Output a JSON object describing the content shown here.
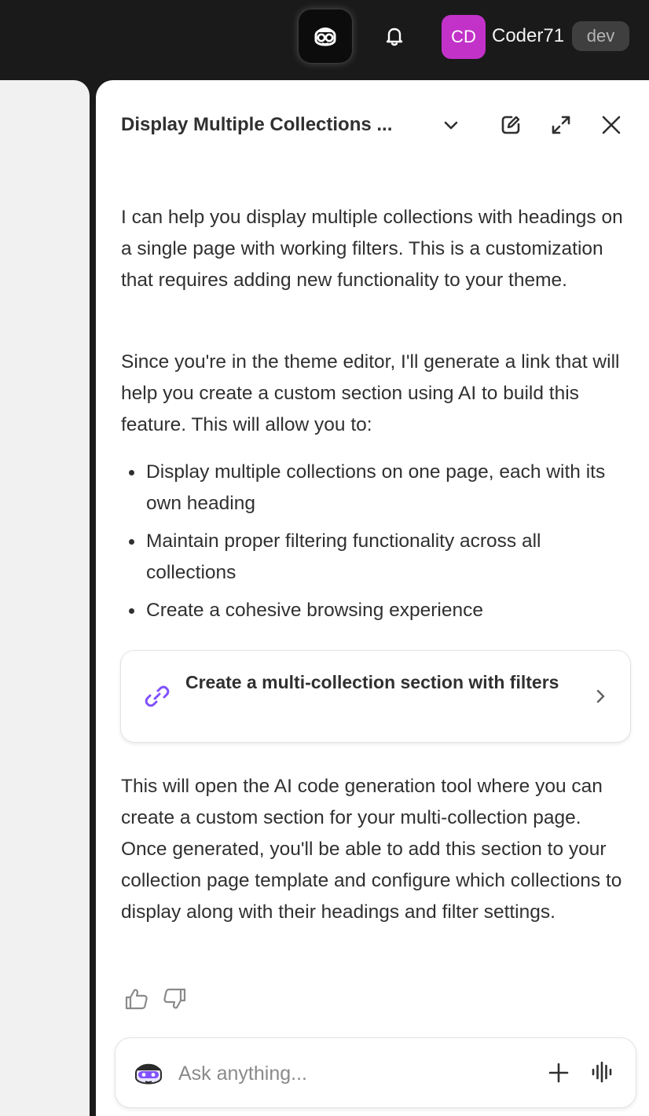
{
  "topbar": {
    "sidekick_icon": "sidekick-face-icon",
    "bell_icon": "bell-icon",
    "avatar_initials": "CD",
    "avatar_color": "#c232c9",
    "username": "Coder71",
    "badge": "dev"
  },
  "chat": {
    "title": "Display Multiple Collections ...",
    "header_icons": [
      "chevron-down-icon",
      "compose-icon",
      "expand-icon",
      "close-icon"
    ],
    "paragraph1": "I can help you display multiple collections with headings on a single page with working filters. This is a customization that requires adding new functionality to your theme.",
    "paragraph2": "Since you're in the theme editor, I'll generate a link that will help you create a custom section using AI to build this feature. This will allow you to:",
    "bullets": [
      "Display multiple collections on one page, each with its own heading",
      "Maintain proper filtering functionality across all collections",
      "Create a cohesive browsing experience"
    ],
    "link_card": {
      "icon": "link-icon",
      "label": "Create a multi-collection section with filters",
      "accent": "#8051ff"
    },
    "paragraph3": "This will open the AI code generation tool where you can create a custom section for your multi-collection page. Once generated, you'll be able to add this section to your collection page template and configure which collections to display along with their headings and filter settings.",
    "feedback_icons": [
      "thumbs-up-icon",
      "thumbs-down-icon"
    ]
  },
  "composer": {
    "placeholder": "Ask anything...",
    "icons": [
      "sidekick-avatar-icon",
      "plus-icon",
      "voice-icon"
    ]
  }
}
